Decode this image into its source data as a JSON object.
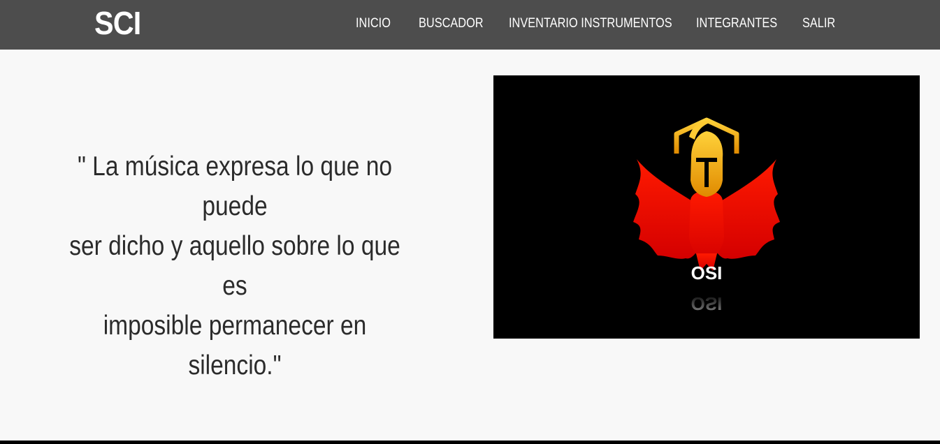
{
  "brand": {
    "label": "SCI"
  },
  "nav": {
    "items": [
      {
        "label": "INICIO"
      },
      {
        "label": "BUSCADOR"
      },
      {
        "label": "INVENTARIO INSTRUMENTOS"
      },
      {
        "label": "INTEGRANTES"
      },
      {
        "label": "SALIR"
      }
    ]
  },
  "main": {
    "quote_lines": [
      "\" La música expresa lo que no puede",
      "ser dicho y aquello sobre lo que es",
      "imposible permanecer en silencio.\""
    ],
    "logo": {
      "icon": "phoenix-spartan-logo-icon",
      "text": "OSI"
    }
  },
  "colors": {
    "navbar_bg": "#4d4d4d",
    "page_bg": "#f8f8f8",
    "text": "#2b2b2b",
    "logo_red": "#e60000",
    "logo_gold": "#f5b400"
  }
}
